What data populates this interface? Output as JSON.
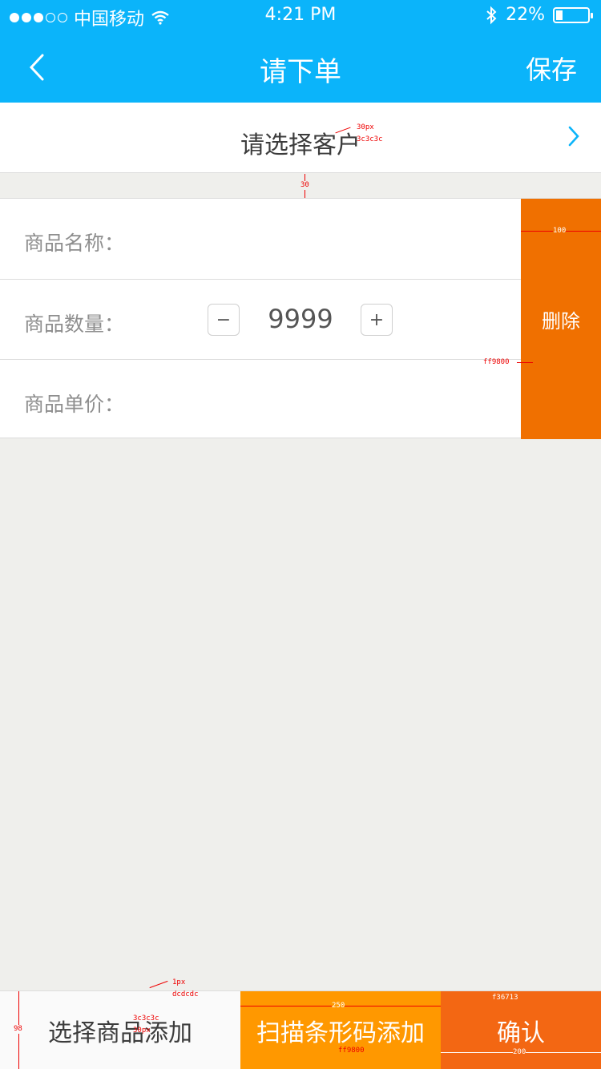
{
  "status_bar": {
    "carrier": "中国移动",
    "time": "4:21 PM",
    "battery_text": "22%",
    "battery_level": 0.22,
    "signal_dots_filled": 3,
    "signal_dots_total": 5
  },
  "nav": {
    "title": "请下单",
    "save_label": "保存",
    "back_icon": "chevron-left-icon"
  },
  "customer": {
    "label": "请选择客户",
    "arrow_icon": "chevron-right-icon"
  },
  "order_item": {
    "name_label": "商品名称：",
    "quantity_label": "商品数量：",
    "quantity_value": "9999",
    "minus_label": "−",
    "plus_label": "+",
    "price_label": "商品单价：",
    "delete_label": "删除"
  },
  "bottom_bar": {
    "select_label": "选择商品添加",
    "scan_label": "扫描条形码添加",
    "confirm_label": "确认"
  },
  "annotations": {
    "customer_font": "30px",
    "customer_color": "3c3c3c",
    "gap": "30",
    "delete_width": "100",
    "delete_color": "ff9800",
    "border_width": "1px",
    "border_color": "dcdcdc",
    "bar_height": "98",
    "select_color": "3c3c3c",
    "select_font": "30px",
    "scan_width": "250",
    "scan_color": "ff9800",
    "confirm_color": "f36713",
    "confirm_width": "200"
  },
  "colors": {
    "nav_bg": "#0bb4fa",
    "delete_bg": "#f07000",
    "scan_bg": "#ff9800",
    "confirm_bg": "#f36713",
    "page_bg": "#efefec",
    "text_dark": "#3c3c3c",
    "divider": "#dcdcdc"
  }
}
